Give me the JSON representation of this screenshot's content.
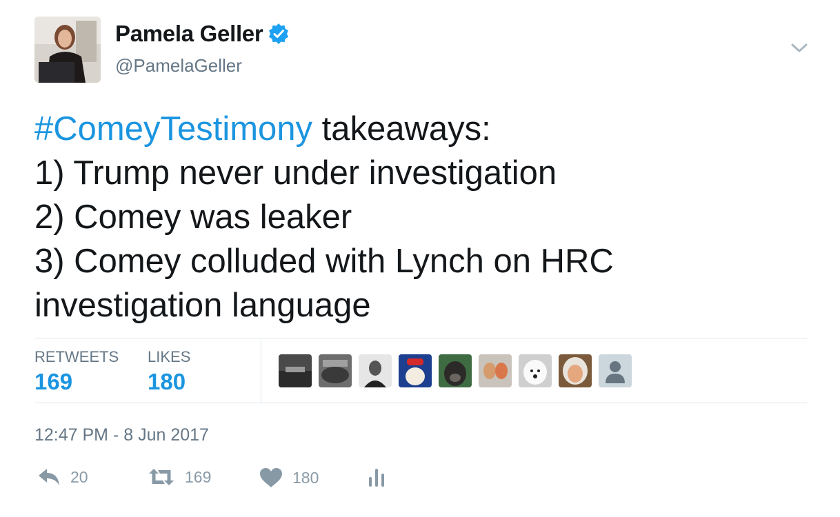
{
  "author": {
    "name": "Pamela Geller",
    "handle": "@PamelaGeller",
    "verified": true
  },
  "tweet": {
    "hashtag": "#ComeyTestimony",
    "lines": [
      " takeaways:",
      "1) Trump never under investigation",
      "2) Comey was leaker",
      "3) Comey colluded with Lynch on HRC",
      "investigation language"
    ]
  },
  "stats": {
    "retweets_label": "RETWEETS",
    "retweets_value": "169",
    "likes_label": "LIKES",
    "likes_value": "180",
    "liker_avatar_count": 9
  },
  "timestamp": "12:47 PM - 8 Jun 2017",
  "actions": {
    "reply_count": "20",
    "retweet_count": "169",
    "like_count": "180"
  },
  "colors": {
    "link": "#1b95e0",
    "verified": "#1da1f2",
    "muted": "#657786",
    "icon": "#8899a6"
  },
  "icons": [
    "verified-badge-icon",
    "chevron-down-icon",
    "reply-icon",
    "retweet-icon",
    "heart-icon",
    "analytics-icon"
  ]
}
